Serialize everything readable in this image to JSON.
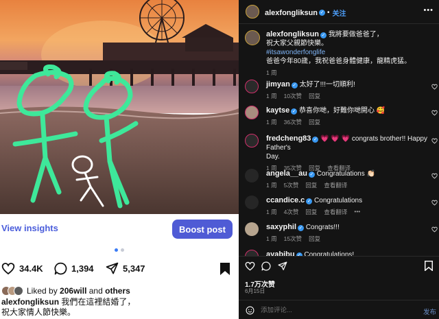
{
  "left": {
    "insights_label": "View insights",
    "boost_label": "Boost post",
    "likes": "34.4K",
    "comments": "1,394",
    "shares": "5,347",
    "liked_by_prefix": "Liked by",
    "liked_by_user": "206will",
    "liked_by_and": "and",
    "liked_by_others": "others",
    "caption_user": "alexfongliksun",
    "caption_line1": "我們在這裡結婚了，",
    "caption_line2": "祝大家情人節快樂。"
  },
  "right": {
    "header": {
      "username": "alexfongliksun",
      "separator": "•",
      "follow_label": "关注"
    },
    "post": {
      "username": "alexfongliksun",
      "text1": "我將要做爸爸了，",
      "text2": "祝大家父親節快樂。",
      "hashtag": "#itsawonderfonglife",
      "text3": "爸爸今年80歲，我祝爸爸身體健康，龍精虎猛。",
      "time": "1 周"
    },
    "comments": [
      {
        "user": "jimyan",
        "text": "太好了!!!一切順利!",
        "time": "1 周",
        "likes": "10次赞",
        "reply": "回复"
      },
      {
        "user": "kaytse",
        "text": "恭喜你哋，好難你哋開心 🥰",
        "time": "1 周",
        "likes": "36次赞",
        "reply": "回复"
      },
      {
        "user": "fredcheng83",
        "text_prefix": "💗 💗 💗 congrats brother!! Happy Father's",
        "text2": "Day.",
        "time": "1 周",
        "likes": "35次赞",
        "reply": "回复",
        "more": "查看翻译"
      },
      {
        "user": "angela__au",
        "text": "Congratulations 👏🏻",
        "time": "1 周",
        "likes": "5次赞",
        "reply": "回复",
        "more": "查看翻译"
      },
      {
        "user": "ccandice.c",
        "text": "Congratulations",
        "time": "1 周",
        "likes": "4次赞",
        "reply": "回复",
        "more": "查看翻译",
        "dots": "•••"
      },
      {
        "user": "saxyphil",
        "text": "Congrats!!!",
        "time": "1 周",
        "likes": "15次赞",
        "reply": "回复"
      },
      {
        "user": "ayabibu",
        "text": "Congratulations!"
      }
    ],
    "footer": {
      "likes_count": "1.7万次赞",
      "date": "6月15日",
      "comment_placeholder": "添加评论...",
      "post_label": "发布"
    }
  },
  "colors": {
    "boost": "#4f5bd5",
    "insights": "#4a5ddb",
    "verified": "#3897f0",
    "link": "#4c9df8"
  }
}
